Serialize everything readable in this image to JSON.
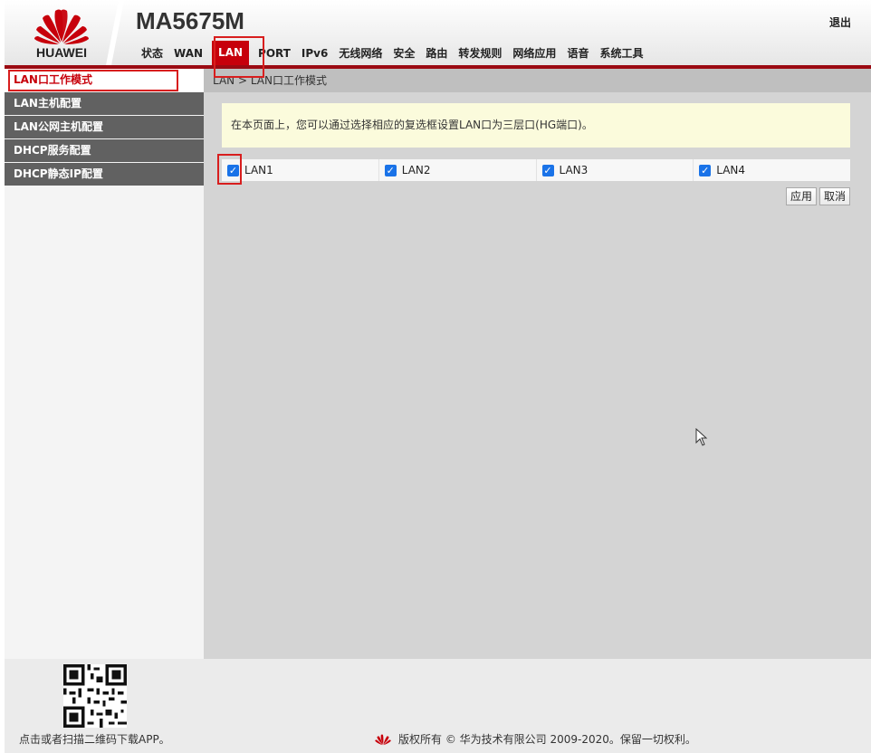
{
  "header": {
    "brand": "HUAWEI",
    "model": "MA5675M",
    "logout": "退出",
    "nav": [
      {
        "label": "状态"
      },
      {
        "label": "WAN"
      },
      {
        "label": "LAN",
        "active": true
      },
      {
        "label": "PORT"
      },
      {
        "label": "IPv6"
      },
      {
        "label": "无线网络"
      },
      {
        "label": "安全"
      },
      {
        "label": "路由"
      },
      {
        "label": "转发规则"
      },
      {
        "label": "网络应用"
      },
      {
        "label": "语音"
      },
      {
        "label": "系统工具"
      }
    ]
  },
  "sidebar": {
    "items": [
      {
        "label": "LAN口工作模式",
        "active": true
      },
      {
        "label": "LAN主机配置"
      },
      {
        "label": "LAN公网主机配置"
      },
      {
        "label": "DHCP服务配置"
      },
      {
        "label": "DHCP静态IP配置"
      }
    ]
  },
  "content": {
    "breadcrumb": "LAN > LAN口工作模式",
    "info": "在本页面上，您可以通过选择相应的复选框设置LAN口为三层口(HG端口)。",
    "lan_ports": [
      {
        "label": "LAN1",
        "checked": true
      },
      {
        "label": "LAN2",
        "checked": true
      },
      {
        "label": "LAN3",
        "checked": true
      },
      {
        "label": "LAN4",
        "checked": true
      }
    ],
    "apply_label": "应用",
    "cancel_label": "取消"
  },
  "footer": {
    "qr_text": "点击或者扫描二维码下载APP。",
    "copyright": "版权所有 © 华为技术有限公司 2009-2020。保留一切权利。"
  },
  "colors": {
    "brand_red": "#c7000b",
    "nav_bar_red": "#9b0a12",
    "sidebar_gray": "#616161",
    "content_gray": "#d4d4d4",
    "info_yellow": "#fbfbdc",
    "highlight_box": "#d81e1e",
    "checkbox_blue": "#1a73e8"
  },
  "icons": {
    "logo": "huawei-petal-logo",
    "checkbox": "checkmark",
    "pointer": "mouse-cursor",
    "qr": "qr-code"
  }
}
